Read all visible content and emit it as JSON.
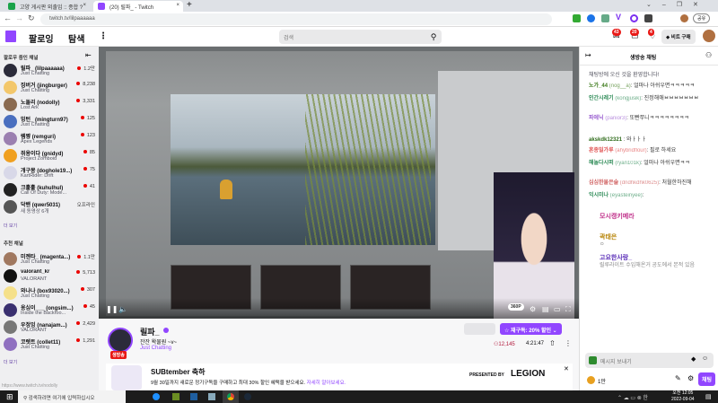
{
  "browser": {
    "tabs": [
      {
        "title": "고양 게시판 외출임 :: 종합 ?"
      },
      {
        "title": "(20) 릴파_ - Twitch"
      }
    ],
    "new_tab": "+",
    "url": "twitch.tv/lilpaaaaaa",
    "profile_label": "공유"
  },
  "nav": {
    "following": "팔로잉",
    "browse": "탐색",
    "more": "⋮",
    "search_placeholder": "검색",
    "badges": [
      "43",
      "20",
      "4"
    ],
    "bits_label": "비트 구매"
  },
  "sidebar": {
    "followed_header": "팔로우 중인 채널",
    "followed": [
      {
        "name": "릴파_ (lilpaaaaaa)",
        "game": "Just Chatting",
        "viewers": "1.2만",
        "color": "#2b2b3a"
      },
      {
        "name": "징버거 (jingburger)",
        "game": "Just Chatting",
        "viewers": "8,238",
        "color": "#f3c76b"
      },
      {
        "name": "노돌리 (nodolly)",
        "game": "Lost Ark",
        "viewers": "3,331",
        "color": "#8a6a50"
      },
      {
        "name": "밍턴_ (mingturn97)",
        "game": "Just Chatting",
        "viewers": "125",
        "color": "#4a6fbf"
      },
      {
        "name": "렘쨩 (remguri)",
        "game": "Apex Legends",
        "viewers": "123",
        "color": "#9b7fb0"
      },
      {
        "name": "쥐용이다 (gnidyd)",
        "game": "Project Zomboid",
        "viewers": "85",
        "color": "#f0a020"
      },
      {
        "name": "개구몽 (doghole19...)",
        "game": "KartRider: Drift",
        "viewers": "75",
        "color": "#d8d8e8"
      },
      {
        "name": "크훌훌 (kuhulhul)",
        "game": "Call Of Duty: Mode...",
        "viewers": "41",
        "color": "#222"
      },
      {
        "name": "닥밴 (qwer5031)",
        "game": "새 동영상 6개",
        "viewers": "오프라인",
        "color": "#555",
        "offline": true
      }
    ],
    "show_more": "더 보기",
    "recommended_header": "추천 채널",
    "recommended": [
      {
        "name": "미젠타_ (magenta...)",
        "game": "Just Chatting",
        "viewers": "1.1만",
        "color": "#a07860"
      },
      {
        "name": "valorant_kr",
        "game": "VALORANT",
        "viewers": "5,713",
        "color": "#111"
      },
      {
        "name": "와나나 (box93020...)",
        "game": "Just Chatting",
        "viewers": "307",
        "color": "#f5e08a"
      },
      {
        "name": "옹심이___ (ongsim...)",
        "game": "Inside the Backroo...",
        "viewers": "45",
        "color": "#3a3070"
      },
      {
        "name": "우정잉 (nanajam...)",
        "game": "VALORANT",
        "viewers": "2,429",
        "color": "#777"
      },
      {
        "name": "코렛트 (collet11)",
        "game": "Just Chatting",
        "viewers": "1,291",
        "color": "#8f70c0"
      }
    ],
    "show_more2": "더 보기",
    "status_url": "https://www.twitch.tv/nodolly"
  },
  "video": {
    "quality": "360P"
  },
  "channel": {
    "name": "릴파_",
    "title": "잔잔 왁물원 ~v~",
    "game": "Just Chatting",
    "live_badge": "생방송",
    "subscribe": "재구독: 20% 할인",
    "viewers": "12,145",
    "uptime": "4:21:47"
  },
  "banner": {
    "title": "SUBtember 축하",
    "text": "9월 30일까지 새로운 정기구독을 구매하고 최대 30% 할인 혜택을 받으세요.",
    "link": "자세히 알아보세요.",
    "presented": "PRESENTED BY",
    "brand": "LEGION"
  },
  "chat": {
    "header": "생방송 채팅",
    "welcome": "채팅방에 오신 것을 환영합니다!",
    "messages": [
      {
        "user": "노가_44",
        "id": "(nog__a)",
        "text": ": 얼마나 아쉬우면ㅋㅋㅋㅋㅋ",
        "color": "#3c7a1a"
      },
      {
        "user": "인간시레기",
        "id": "(kongjusik)",
        "text": ": 진정해애ㅂㅂㅂㅂㅂㅂㅂ",
        "color": "#2e8b57"
      },
      {
        "user": "파에닉",
        "id": "(panior3)",
        "text": ": 또빤쭈니ㅋㅋㅋㅋㅋㅋㅋㅋ",
        "color": "#9a5fd0"
      },
      {
        "user": "akskdk12321",
        "id": "",
        "text": ": 와ㅏㅏㅏ",
        "color": "#2e6b1a"
      },
      {
        "user": "혼종밀가루",
        "id": "(ahybridflour)",
        "text": ": 필로 하세요",
        "color": "#e05050"
      },
      {
        "user": "해놀다시떠",
        "id": "(ryan101k)",
        "text": ": 얼마나 아쉬우면ㅋㅋ",
        "color": "#2e8b57"
      },
      {
        "user": "심심한물은술",
        "id": "(dndhkdhk0625)",
        "text": ": 처월한하진해",
        "color": "#d06060"
      },
      {
        "user": "익시미나",
        "id": "(eyasteinyee)",
        "text": ":",
        "color": "#2e8b57"
      }
    ],
    "overlay": [
      {
        "user": "모시캥키메라",
        "text": "",
        "color": "#c0308a"
      },
      {
        "user": "곽태은",
        "text": "ㅇ",
        "color": "#b8860b"
      },
      {
        "user": "고요한사랑_",
        "text": "릴루라이트 수입해온거 공도에서 본적 있음",
        "color": "#5b2fb8"
      }
    ],
    "input_placeholder": "메시지 보내기",
    "points": "1만",
    "send": "채팅"
  },
  "taskbar": {
    "search": "검색하려면 여기에 입력하십시오",
    "time": "오전 12:05",
    "date": "2022-09-04"
  }
}
